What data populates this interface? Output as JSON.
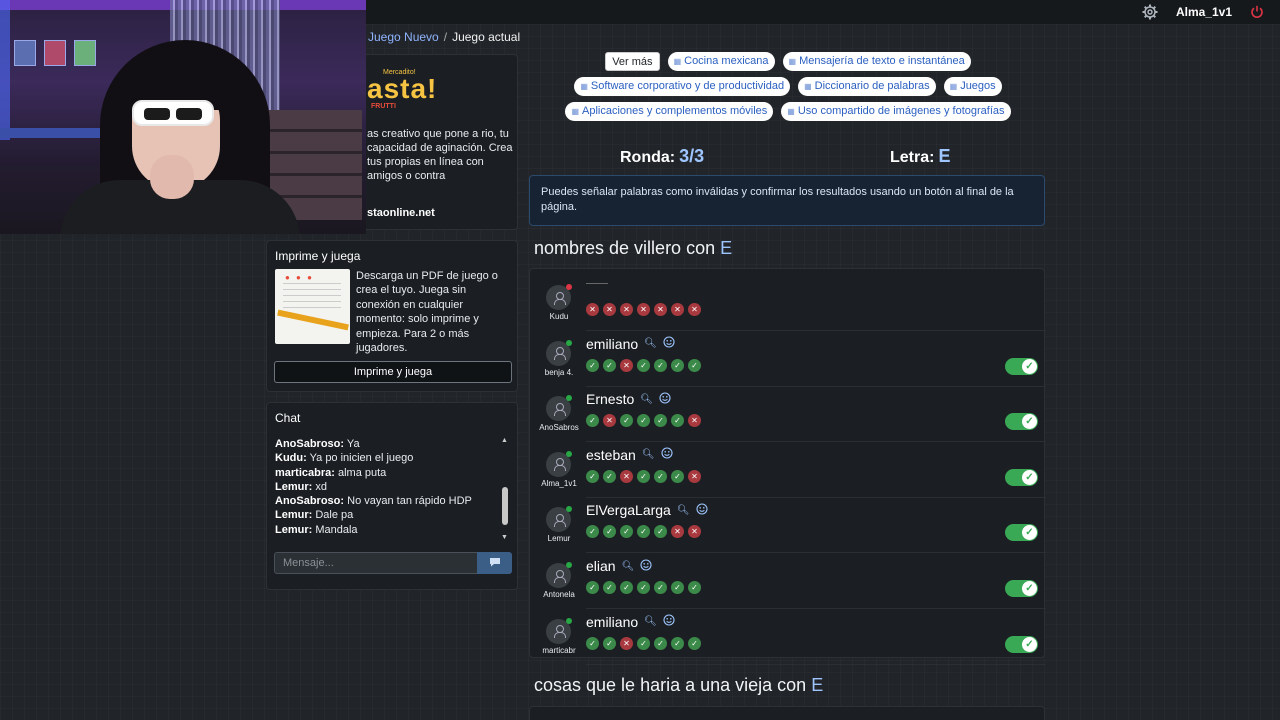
{
  "nav": {
    "user": "Alma_1v1",
    "settings_icon": "gear-icon",
    "power_icon": "power-icon",
    "power_color": "#dc3545"
  },
  "breadcrumb": {
    "link": "Juego Nuevo",
    "current": "Juego actual"
  },
  "promo": {
    "logo_top": "Mercadito!",
    "logo": "asta!",
    "logo_sub": "FRUTTI",
    "description": "as creativo que pone a rio, tu capacidad de aginación. Crea tus propias en línea con amigos o contra",
    "site": "staonline.net"
  },
  "print": {
    "title": "Imprime y juega",
    "description": "Descarga un PDF de juego o crea el tuyo. Juega sin conexión en cualquier momento: solo imprime y empieza. Para 2 o más jugadores.",
    "button": "Imprime y juega"
  },
  "chat": {
    "title": "Chat",
    "messages": [
      {
        "user": "AnoSabroso:",
        "text": "Ya"
      },
      {
        "user": "Kudu:",
        "text": "Ya po inicien el juego"
      },
      {
        "user": "marticabra:",
        "text": "alma puta"
      },
      {
        "user": "Lemur:",
        "text": "xd"
      },
      {
        "user": "AnoSabroso:",
        "text": "No vayan tan rápido HDP"
      },
      {
        "user": "Lemur:",
        "text": "Dale pa"
      },
      {
        "user": "Lemur:",
        "text": "Mandala"
      }
    ],
    "placeholder": "Mensaje..."
  },
  "tags": {
    "more": "Ver más",
    "items": [
      "Cocina mexicana",
      "Mensajería de texto e instantánea",
      "Software corporativo y de productividad",
      "Diccionario de palabras",
      "Juegos",
      "Aplicaciones y complementos móviles",
      "Uso compartido de imágenes y fotografías"
    ]
  },
  "round": {
    "label": "Ronda:",
    "value": "3/3"
  },
  "letter": {
    "label": "Letra:",
    "value": "E"
  },
  "info": "Puedes señalar palabras como inválidas y confirmar los resultados usando un botón al final de la página.",
  "category1": {
    "title": "nombres de villero con ",
    "letter": "E"
  },
  "category2": {
    "title": "cosas que le haria a una vieja con ",
    "letter": "E"
  },
  "answers": [
    {
      "player": "Kudu",
      "word": "",
      "status": "#dc3545",
      "votes": [
        0,
        0,
        0,
        0,
        0,
        0,
        0
      ],
      "toggle": false
    },
    {
      "player": "benja 4.",
      "word": "emiliano",
      "status": "#28a745",
      "votes": [
        1,
        1,
        0,
        1,
        1,
        1,
        1
      ],
      "toggle": true
    },
    {
      "player": "AnoSabros",
      "word": "Ernesto",
      "status": "#28a745",
      "votes": [
        1,
        0,
        1,
        1,
        1,
        1,
        0
      ],
      "toggle": true
    },
    {
      "player": "Alma_1v1",
      "word": "esteban",
      "status": "#28a745",
      "votes": [
        1,
        1,
        0,
        1,
        1,
        1,
        0
      ],
      "toggle": true
    },
    {
      "player": "Lemur",
      "word": "ElVergaLarga",
      "status": "#28a745",
      "votes": [
        1,
        1,
        1,
        1,
        1,
        0,
        0
      ],
      "toggle": true
    },
    {
      "player": "Antonela",
      "word": "elian",
      "status": "#28a745",
      "votes": [
        1,
        1,
        1,
        1,
        1,
        1,
        1
      ],
      "toggle": true
    },
    {
      "player": "marticabr",
      "word": "emiliano",
      "status": "#28a745",
      "votes": [
        1,
        1,
        0,
        1,
        1,
        1,
        1
      ],
      "toggle": true
    }
  ],
  "colors": {
    "accent": "#9ec5fe",
    "vote_ok": "#3c8a4a",
    "vote_no": "#a8393f",
    "toggle_on": "#3aa956"
  }
}
